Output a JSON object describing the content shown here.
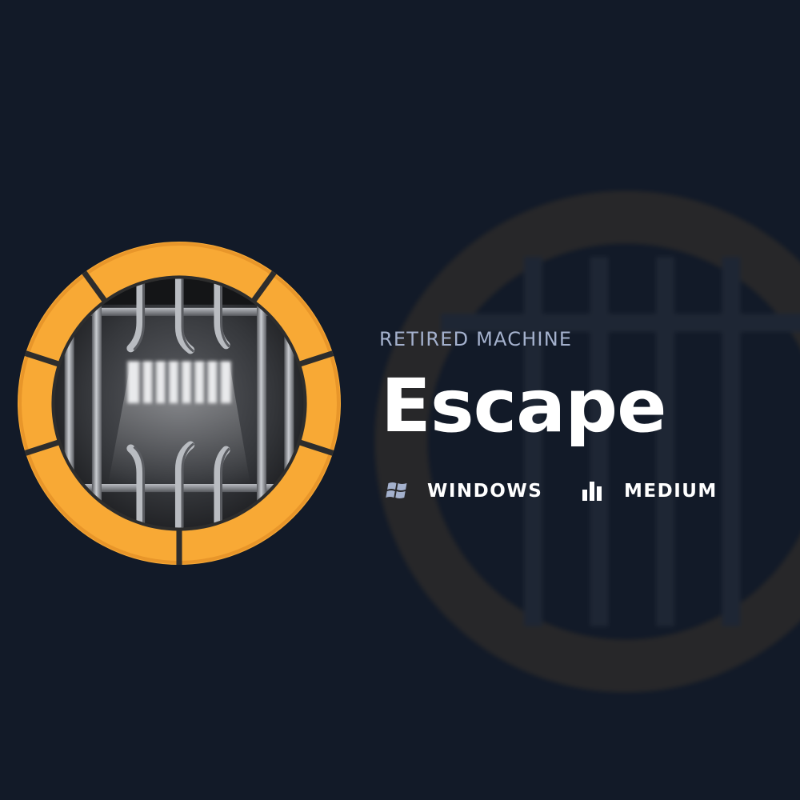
{
  "machine": {
    "status": "RETIRED MACHINE",
    "name": "Escape",
    "os": "WINDOWS",
    "difficulty": "MEDIUM"
  },
  "colors": {
    "background": "#121a28",
    "accent_orange": "#f8a935",
    "ring_dark": "#2d2d2d",
    "label_muted": "#a4b1cd",
    "text_primary": "#ffffff",
    "icon_muted": "#a4b1cd"
  },
  "icons": {
    "badge": "jail-cell-bars-icon",
    "os": "windows-logo-icon",
    "difficulty": "bar-chart-icon"
  }
}
